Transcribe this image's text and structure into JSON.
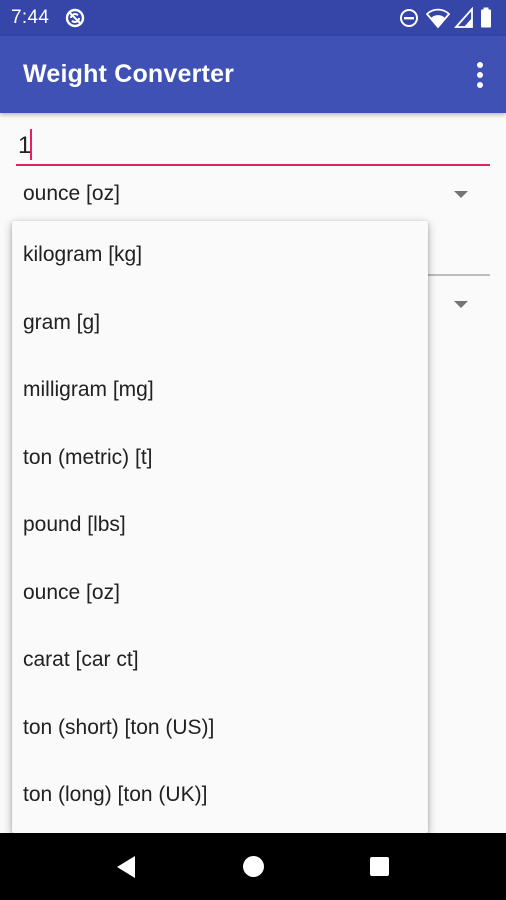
{
  "status_bar": {
    "time": "7:44",
    "icons": [
      "sync-disabled-icon",
      "do-not-disturb-icon",
      "wifi-icon",
      "cell-signal-icon",
      "battery-icon"
    ]
  },
  "app_bar": {
    "title": "Weight Converter",
    "menu_icon": "more-vert-icon"
  },
  "input": {
    "value": "1"
  },
  "from_unit": {
    "selected": "ounce [oz]"
  },
  "to_unit": {
    "selected": ""
  },
  "dropdown": {
    "options": [
      "kilogram [kg]",
      "gram [g]",
      "milligram [mg]",
      "ton (metric) [t]",
      "pound [lbs]",
      "ounce [oz]",
      "carat [car ct]",
      "ton (short) [ton (US)]",
      "ton (long) [ton (UK)]"
    ]
  },
  "nav_bar": {
    "icons": [
      "back-icon",
      "home-icon",
      "recents-icon"
    ]
  },
  "colors": {
    "primary": "#3f51b5",
    "primary_dark": "#3545a8",
    "accent": "#e91e63"
  }
}
